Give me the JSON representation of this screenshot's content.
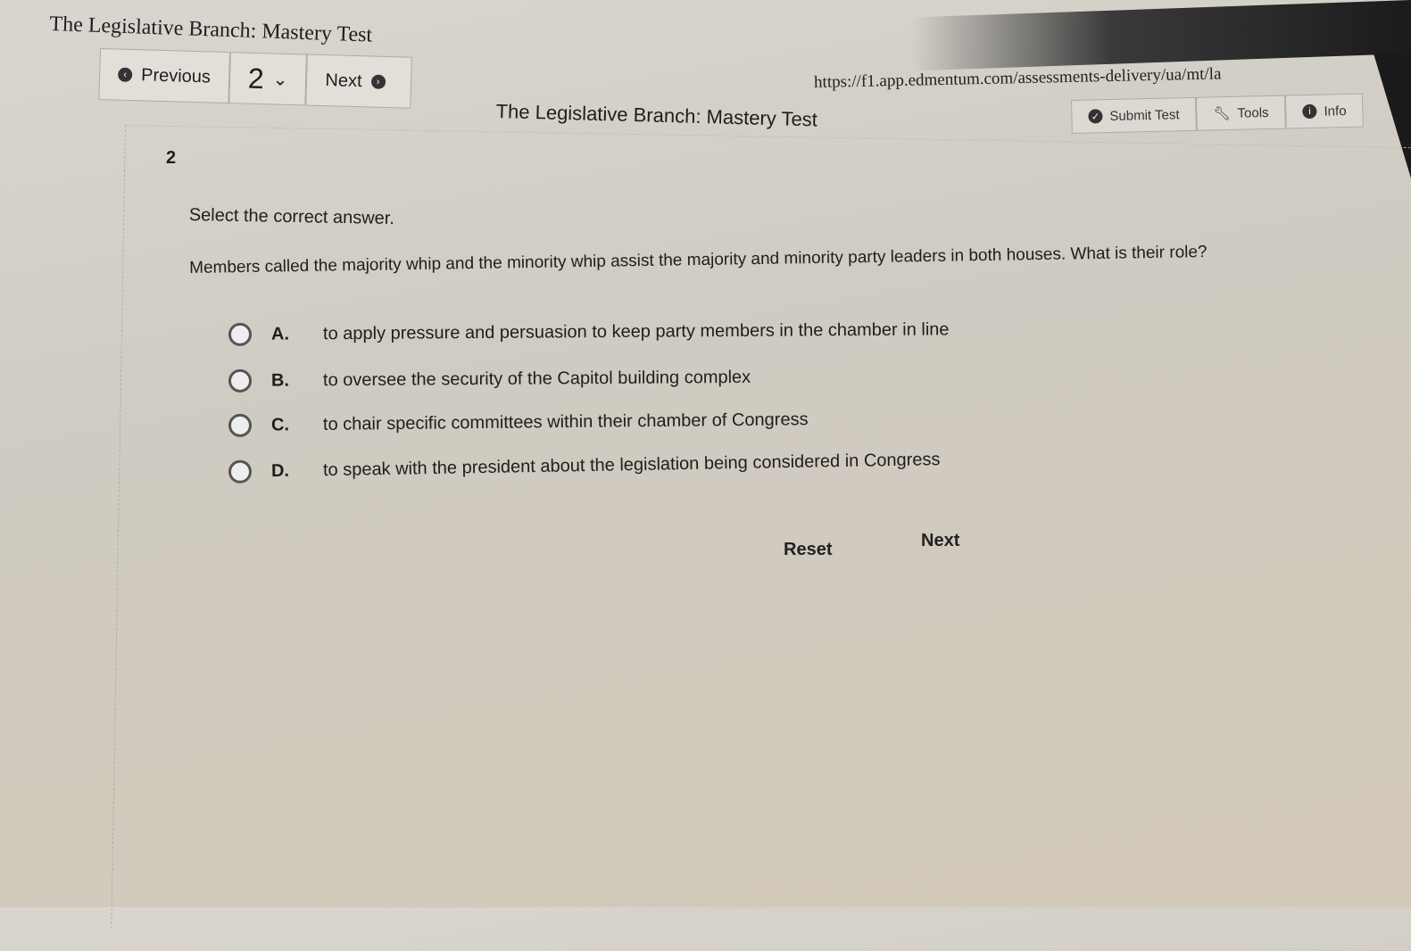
{
  "window_title": "The Legislative Branch: Mastery Test",
  "url": "https://f1.app.edmentum.com/assessments-delivery/ua/mt/la",
  "nav": {
    "previous": "Previous",
    "question_number": "2",
    "next": "Next"
  },
  "page_title": "The Legislative Branch: Mastery Test",
  "tools": {
    "submit": "Submit Test",
    "tools": "Tools",
    "info": "Info"
  },
  "question": {
    "number": "2",
    "instruction": "Select the correct answer.",
    "text": "Members called the majority whip and the minority whip assist the majority and minority party leaders in both houses. What is their role?",
    "options": [
      {
        "letter": "A.",
        "text": "to apply pressure and persuasion to keep party members in the chamber in line"
      },
      {
        "letter": "B.",
        "text": "to oversee the security of the Capitol building complex"
      },
      {
        "letter": "C.",
        "text": "to chair specific committees within their chamber of Congress"
      },
      {
        "letter": "D.",
        "text": "to speak with the president about the legislation being considered in Congress"
      }
    ]
  },
  "actions": {
    "reset": "Reset",
    "next": "Next"
  }
}
